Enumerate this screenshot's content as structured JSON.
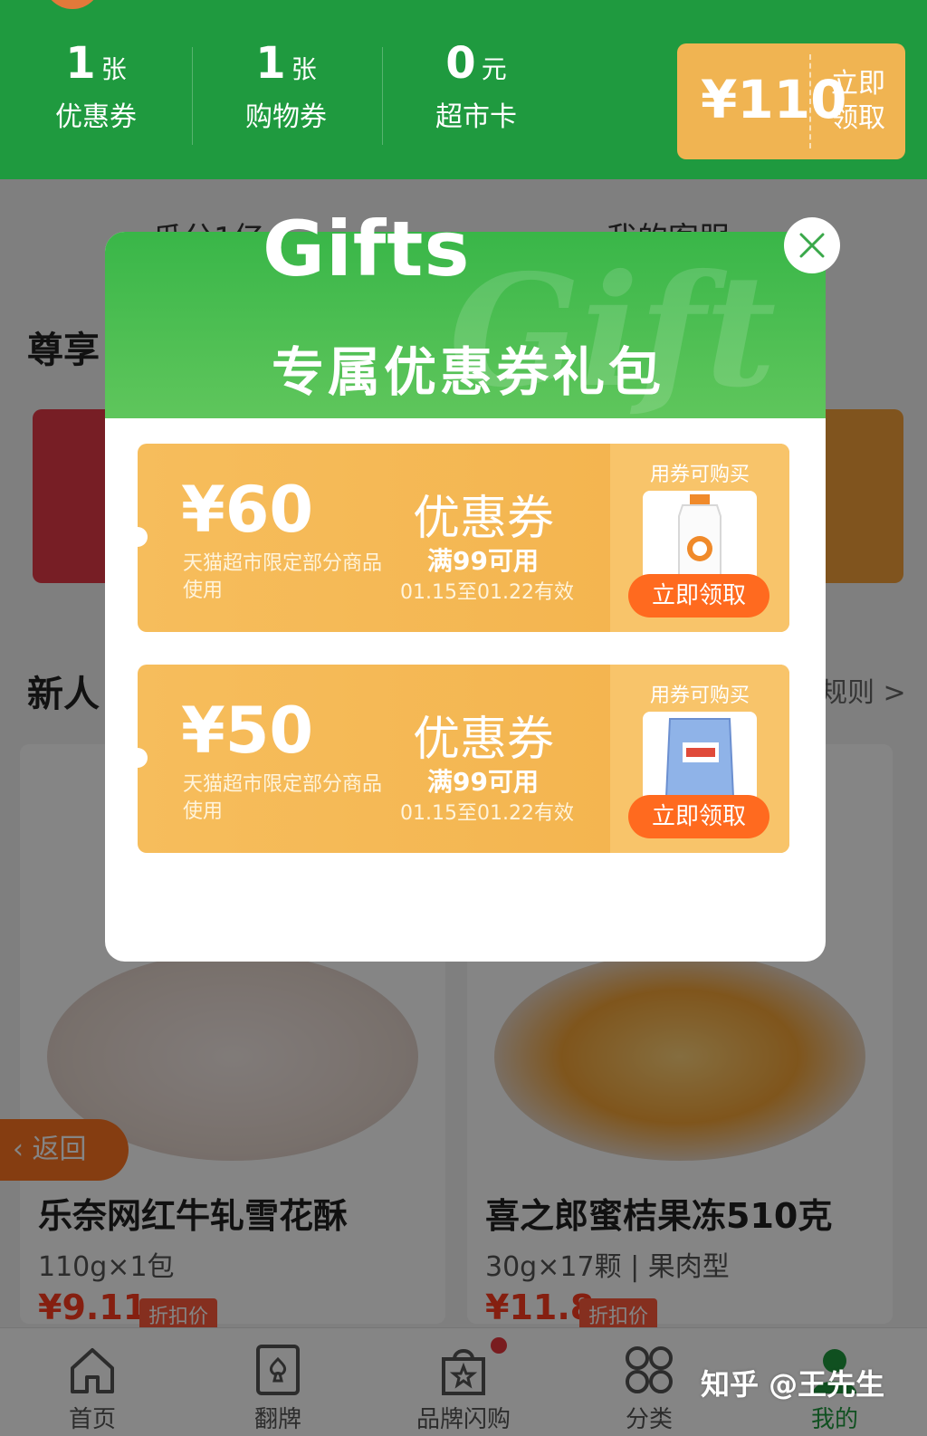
{
  "header": {
    "stats": [
      {
        "num": "1",
        "unit": "张",
        "label": "优惠券"
      },
      {
        "num": "1",
        "unit": "张",
        "label": "购物券"
      },
      {
        "num": "0",
        "unit": "元",
        "label": "超市卡"
      }
    ],
    "gift_ticket": {
      "amount": "¥110",
      "claim": "立即领取"
    }
  },
  "background": {
    "mid_left": "瓜分1亿",
    "mid_right": "我的客服",
    "section_exclusive": "尊享",
    "section_newcomer": "新人",
    "rules_link": "规则 >",
    "products": [
      {
        "name": "乐奈网红牛轧雪花酥",
        "spec": "110g×1包",
        "price": "¥9.11",
        "tag": "折扣价"
      },
      {
        "name": "喜之郎蜜桔果冻510克",
        "spec": "30g×17颗  |  果肉型",
        "price": "¥11.8",
        "tag": "折扣价"
      }
    ],
    "back_button": "返回"
  },
  "tabbar": {
    "tabs": [
      {
        "label": "首页",
        "icon": "home-icon"
      },
      {
        "label": "翻牌",
        "icon": "card-flip-icon"
      },
      {
        "label": "品牌闪购",
        "icon": "shopping-bag-icon"
      },
      {
        "label": "分类",
        "icon": "category-grid-icon"
      },
      {
        "label": "我的",
        "icon": "profile-icon"
      }
    ],
    "active_color": "#1f9a3f",
    "badge_color": "#e8363d"
  },
  "watermark": "知乎 @王先生",
  "modal": {
    "script_bg": "Gift",
    "gifts_word": "Gifts",
    "title": "专属优惠券礼包",
    "close_icon": "close-icon",
    "coupons": [
      {
        "amount": "¥60",
        "scope": "天猫超市限定部分商品使用",
        "kind": "优惠券",
        "condition": "满99可用",
        "valid": "01.15至01.22有效",
        "buy_label": "用券可购买",
        "claim": "立即领取",
        "product_icon": "shampoo-bottle-icon"
      },
      {
        "amount": "¥50",
        "scope": "天猫超市限定部分商品使用",
        "kind": "优惠券",
        "condition": "满99可用",
        "valid": "01.15至01.22有效",
        "buy_label": "用券可购买",
        "claim": "立即领取",
        "product_icon": "snack-bag-icon"
      }
    ]
  },
  "colors": {
    "brand_green": "#1f9a3f",
    "coupon_orange": "#f3b24b",
    "claim_orange": "#ff6a1f",
    "price_red": "#ff3d20"
  }
}
